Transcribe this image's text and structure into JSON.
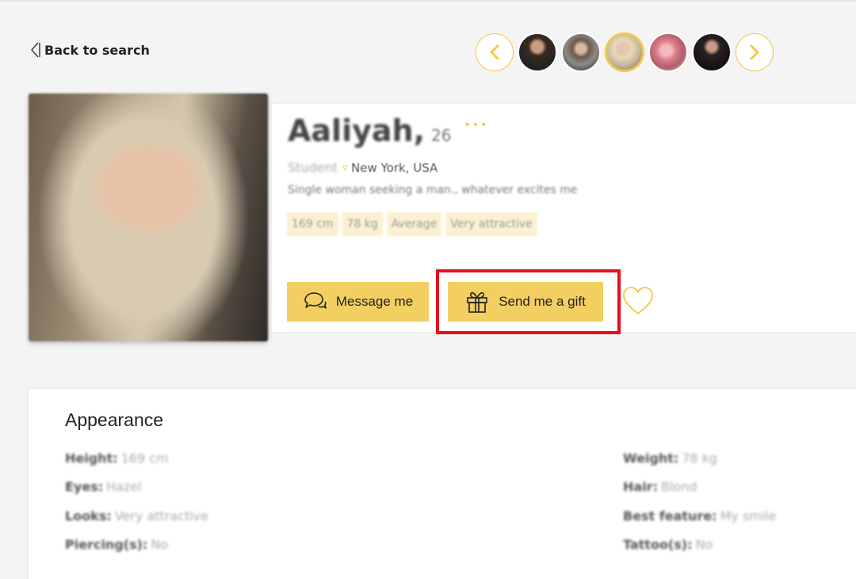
{
  "nav": {
    "back_label": "Back to search"
  },
  "carousel": {
    "thumbnails": [
      "profile-photo-1",
      "profile-photo-2",
      "profile-photo-3",
      "profile-photo-4",
      "profile-photo-5"
    ],
    "active_index": 2,
    "accent_color": "#eec94c"
  },
  "profile": {
    "name": "Aaliyah,",
    "age": "26",
    "rating": "•••",
    "occupation": "Student",
    "location": "New York, USA",
    "tagline": "Single woman seeking a man., whatever excites me",
    "tags": [
      "169 cm",
      "78 kg",
      "Average",
      "Very attractive"
    ]
  },
  "actions": {
    "message_label": "Message me",
    "gift_label": "Send me a gift",
    "button_color": "#f3cf62",
    "highlight_color": "#e3101a"
  },
  "appearance": {
    "title": "Appearance",
    "left": [
      {
        "key": "Height:",
        "value": "169 cm"
      },
      {
        "key": "Eyes:",
        "value": "Hazel"
      },
      {
        "key": "Looks:",
        "value": "Very attractive"
      },
      {
        "key": "Piercing(s):",
        "value": "No"
      }
    ],
    "right": [
      {
        "key": "Weight:",
        "value": "78 kg"
      },
      {
        "key": "Hair:",
        "value": "Blond"
      },
      {
        "key": "Best feature:",
        "value": "My smile"
      },
      {
        "key": "Tattoo(s):",
        "value": "No"
      }
    ]
  }
}
